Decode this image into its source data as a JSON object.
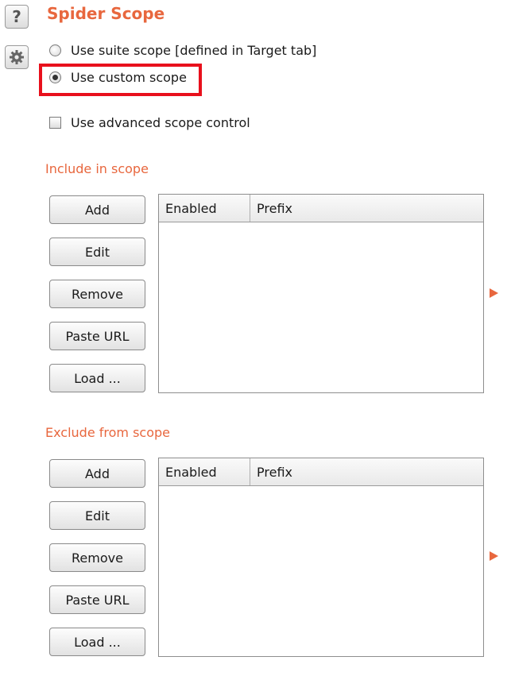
{
  "icons": {
    "help": "question-mark",
    "settings": "gear"
  },
  "title": "Spider Scope",
  "scope_options": {
    "suite_scope": {
      "label": "Use suite scope [defined in Target tab]",
      "checked": false
    },
    "custom_scope": {
      "label": "Use custom scope",
      "checked": true
    }
  },
  "advanced_control": {
    "label": "Use advanced scope control",
    "checked": false
  },
  "include": {
    "label": "Include in scope",
    "buttons": {
      "add": "Add",
      "edit": "Edit",
      "remove": "Remove",
      "paste_url": "Paste URL",
      "load": "Load ..."
    },
    "columns": {
      "enabled": "Enabled",
      "prefix": "Prefix"
    },
    "rows": []
  },
  "exclude": {
    "label": "Exclude from scope",
    "buttons": {
      "add": "Add",
      "edit": "Edit",
      "remove": "Remove",
      "paste_url": "Paste URL",
      "load": "Load ..."
    },
    "columns": {
      "enabled": "Enabled",
      "prefix": "Prefix"
    },
    "rows": []
  },
  "colors": {
    "accent": "#e8673e",
    "highlight": "#e8101c"
  }
}
